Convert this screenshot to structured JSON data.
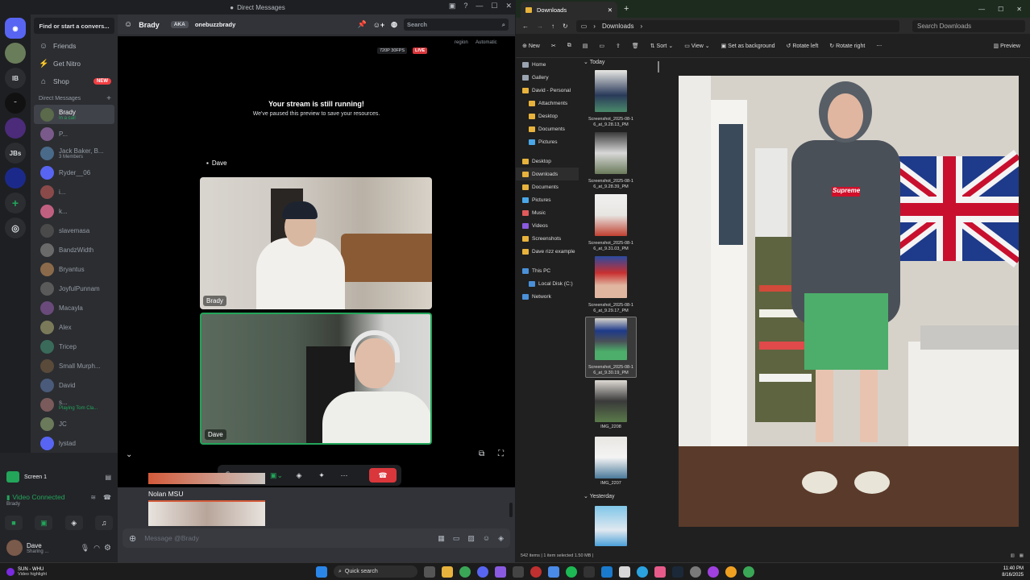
{
  "discord": {
    "window_title": "Direct Messages",
    "find_placeholder": "Find or start a convers...",
    "nav": [
      {
        "label": "Friends",
        "icon": "friends-icon"
      },
      {
        "label": "Get Nitro",
        "icon": "nitro-icon"
      },
      {
        "label": "Shop",
        "icon": "shop-icon",
        "badge": "NEW"
      }
    ],
    "dm_header": "Direct Messages",
    "guilds": [
      "IB",
      "JBs"
    ],
    "dms": [
      {
        "name": "Brady",
        "sub": "In a call"
      },
      {
        "name": "P...",
        "sub": ""
      },
      {
        "name": "Jack Baker, B...",
        "sub": "3 Members"
      },
      {
        "name": "Ryder__06",
        "sub": ""
      },
      {
        "name": "i...",
        "sub": ""
      },
      {
        "name": "k...",
        "sub": ""
      },
      {
        "name": "slavemasa",
        "sub": ""
      },
      {
        "name": "BandzWidth",
        "sub": ""
      },
      {
        "name": "Bryantus",
        "sub": ""
      },
      {
        "name": "JoyfulPunnam",
        "sub": ""
      },
      {
        "name": "Macayla",
        "sub": ""
      },
      {
        "name": "Alex",
        "sub": ""
      },
      {
        "name": "Tricep",
        "sub": ""
      },
      {
        "name": "Small Murph...",
        "sub": ""
      },
      {
        "name": "David",
        "sub": ""
      },
      {
        "name": "s...",
        "sub": "Playing Tom Cla..."
      },
      {
        "name": "JC",
        "sub": ""
      },
      {
        "name": "lystad",
        "sub": ""
      }
    ],
    "voice": {
      "screen_label": "Screen 1",
      "connected": "Video Connected",
      "channel": "Brady",
      "user_name": "Dave",
      "user_status": "Sharing ..."
    },
    "header": {
      "name": "Brady",
      "aka": "AKA",
      "aka_name": "onebuzzbrady",
      "search_placeholder": "Search"
    },
    "call": {
      "quality": "720P 30FPS",
      "live": "LIVE",
      "region_label": "region",
      "region_value": "Automatic",
      "stream_title": "Your stream is still running!",
      "stream_sub": "We've paused this preview to save your resources.",
      "stream_owner": "Dave",
      "tile_brady": "Brady",
      "tile_dave": "Dave"
    },
    "chat": {
      "author": "Nolan MSU",
      "placeholder": "Message @Brady"
    }
  },
  "explorer": {
    "tab_title": "Downloads",
    "address": "Downloads",
    "search_placeholder": "Search Downloads",
    "toolbar": [
      "New",
      "Sort",
      "View",
      "Set as background",
      "Rotate left",
      "Rotate right",
      "Preview"
    ],
    "nav": [
      {
        "label": "Home",
        "indent": 0
      },
      {
        "label": "Gallery",
        "indent": 0
      },
      {
        "label": "David - Personal",
        "indent": 0
      },
      {
        "label": "Attachments",
        "indent": 1
      },
      {
        "label": "Desktop",
        "indent": 1
      },
      {
        "label": "Documents",
        "indent": 1
      },
      {
        "label": "Pictures",
        "indent": 1
      },
      {
        "label": "Desktop",
        "indent": 0
      },
      {
        "label": "Downloads",
        "indent": 0
      },
      {
        "label": "Documents",
        "indent": 0
      },
      {
        "label": "Pictures",
        "indent": 0
      },
      {
        "label": "Music",
        "indent": 0
      },
      {
        "label": "Videos",
        "indent": 0
      },
      {
        "label": "Screenshots",
        "indent": 0
      },
      {
        "label": "Dave rizz example",
        "indent": 0
      },
      {
        "label": "This PC",
        "indent": 0
      },
      {
        "label": "Local Disk (C:)",
        "indent": 1
      },
      {
        "label": "Network",
        "indent": 0
      }
    ],
    "group_today": "Today",
    "group_yesterday": "Yesterday",
    "files": [
      {
        "name1": "Screenshot_2025-08-1",
        "name2": "6_at_9.28.13_PM"
      },
      {
        "name1": "Screenshot_2025-08-1",
        "name2": "6_at_9.28.39_PM"
      },
      {
        "name1": "Screenshot_2025-08-1",
        "name2": "6_at_9.31.03_PM"
      },
      {
        "name1": "Screenshot_2025-08-1",
        "name2": "6_at_9.29.17_PM"
      },
      {
        "name1": "Screenshot_2025-08-1",
        "name2": "6_at_9.30.19_PM"
      },
      {
        "name1": "IMG_2208",
        "name2": ""
      },
      {
        "name1": "IMG_2207",
        "name2": ""
      }
    ],
    "status": "542 items  |  1 item selected  1.50 MB  |"
  },
  "taskbar": {
    "weather": "SUN - WHU",
    "weather_sub": "Video highlight",
    "search": "Quick search",
    "time": "11:40 PM",
    "date": "8/16/2025"
  },
  "colors": {
    "discord_bg": "#313338",
    "green": "#23a55a",
    "red": "#da373c",
    "blurple": "#5865f2"
  }
}
